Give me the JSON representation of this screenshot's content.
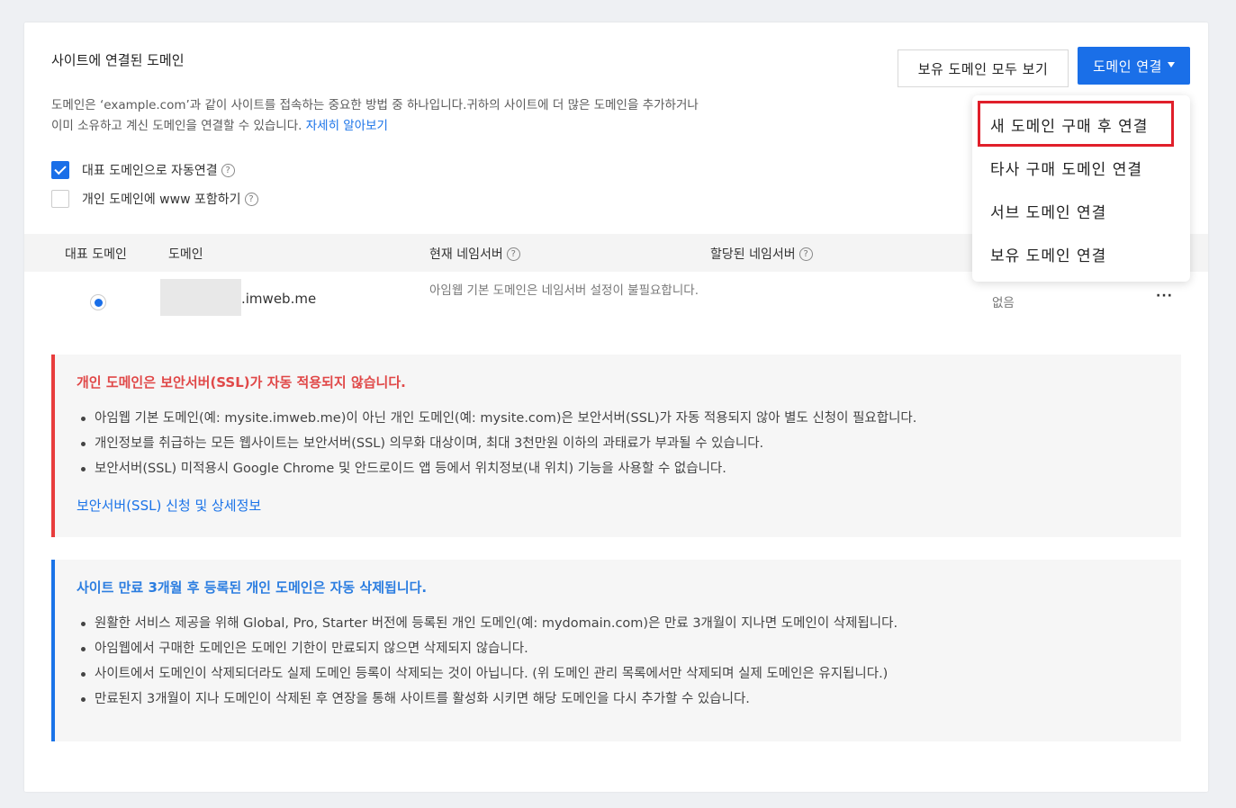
{
  "section": {
    "title": "사이트에 연결된 도메인",
    "description": "도메인은 ‘example.com’과 같이 사이트를 접속하는 중요한 방법 중 하나입니다.귀하의 사이트에 더 많은 도메인을 추가하거나 이미 소유하고 계신 도메인을 연결할 수 있습니다.",
    "learn_more": "자세히 알아보기"
  },
  "buttons": {
    "view_all": "보유 도메인 모두 보기",
    "connect": "도메인 연결"
  },
  "dropdown": {
    "items": [
      "새 도메인 구매 후 연결",
      "타사 구매 도메인 연결",
      "서브 도메인 연결",
      "보유 도메인 연결"
    ]
  },
  "options": {
    "auto_primary": {
      "label": "대표 도메인으로 자동연결",
      "checked": true
    },
    "include_www": {
      "label": "개인 도메인에 www 포함하기",
      "checked": false
    }
  },
  "help_glyph": "?",
  "table": {
    "headers": [
      "대표 도메인",
      "도메인",
      "현재 네임서버",
      "할당된 네임서버"
    ],
    "rows": [
      {
        "domain_suffix": ".imweb.me",
        "nameserver_note": "아임웹 기본 도메인은 네임서버 설정이 불필요합니다.",
        "status": "없음",
        "more": "···"
      }
    ]
  },
  "notice_ssl": {
    "title": "개인 도메인은 보안서버(SSL)가 자동 적용되지 않습니다.",
    "items": [
      "아임웹 기본 도메인(예: mysite.imweb.me)이 아닌 개인 도메인(예: mysite.com)은 보안서버(SSL)가 자동 적용되지 않아 별도 신청이 필요합니다.",
      "개인정보를 취급하는 모든 웹사이트는 보안서버(SSL) 의무화 대상이며, 최대 3천만원 이하의 과태료가 부과될 수 있습니다.",
      "보안서버(SSL) 미적용시 Google Chrome 및 안드로이드 앱 등에서 위치정보(내 위치) 기능을 사용할 수 없습니다."
    ],
    "link": "보안서버(SSL) 신청 및 상세정보"
  },
  "notice_expire": {
    "title": "사이트 만료 3개월 후 등록된 개인 도메인은 자동 삭제됩니다.",
    "items": [
      "원활한 서비스 제공을 위해 Global, Pro, Starter 버전에 등록된 개인 도메인(예: mydomain.com)은 만료 3개월이 지나면 도메인이 삭제됩니다.",
      "아임웹에서 구매한 도메인은 도메인 기한이 만료되지 않으면 삭제되지 않습니다.",
      "사이트에서 도메인이 삭제되더라도 실제 도메인 등록이 삭제되는 것이 아닙니다. (위 도메인 관리 목록에서만 삭제되며 실제 도메인은 유지됩니다.)",
      "만료된지 3개월이 지나 도메인이 삭제된 후 연장을 통해 사이트를 활성화 시키면 해당 도메인을 다시 추가할 수 있습니다."
    ]
  }
}
